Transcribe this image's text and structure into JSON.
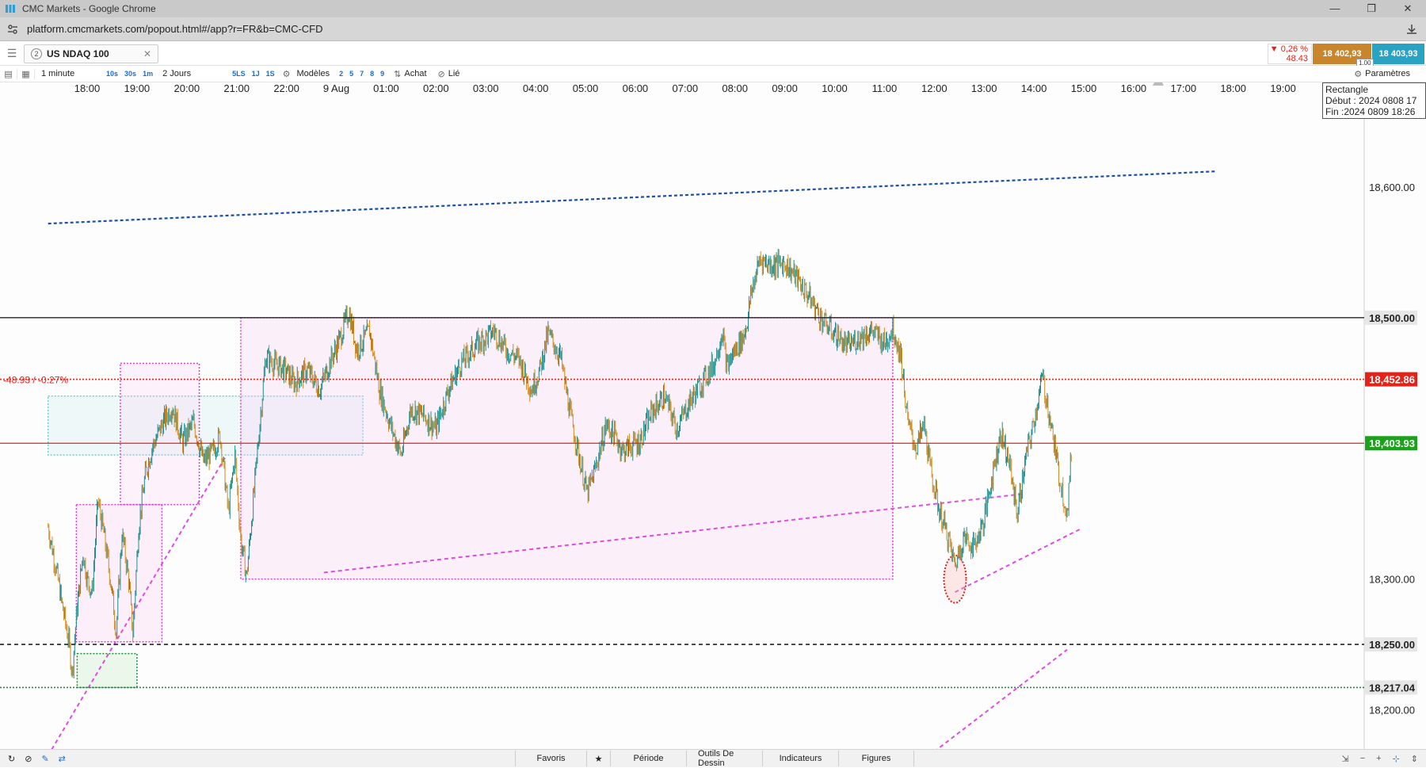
{
  "window": {
    "title": "CMC Markets - Google Chrome",
    "controls": [
      "—",
      "❐",
      "✕"
    ]
  },
  "address": {
    "url": "platform.cmcmarkets.com/popout.html#/app?r=FR&b=CMC-CFD"
  },
  "instrument": {
    "tab_number": "2",
    "name": "US NDAQ 100",
    "change_pct": "▼ 0,26 %",
    "change_pts": "48.43",
    "sell": "18 402,93",
    "buy": "18 403,93",
    "spread": "1.00"
  },
  "toolbar": {
    "interval": "1 minute",
    "quick_intervals": [
      "10s",
      "30s",
      "1m"
    ],
    "range": "2 Jours",
    "quick_ranges": [
      "5LS",
      "1J",
      "1S"
    ],
    "models": "Modèles",
    "model_slots": [
      "2",
      "5",
      "7",
      "8",
      "9"
    ],
    "buy_label": "Achat",
    "linked_label": "Lié",
    "params_label": "Paramètres"
  },
  "tooltip": {
    "line1": "Rectangle",
    "line2": "Début : 2024 0808 17",
    "line3": "Fin :2024 0809 18:26"
  },
  "chart_data": {
    "type": "candlestick",
    "instrument": "US NDAQ 100",
    "timeframe": "1 minute",
    "x_ticks": [
      "18:00",
      "19:00",
      "20:00",
      "21:00",
      "22:00",
      "9 Aug",
      "01:00",
      "02:00",
      "03:00",
      "04:00",
      "05:00",
      "06:00",
      "07:00",
      "08:00",
      "09:00",
      "10:00",
      "11:00",
      "12:00",
      "13:00",
      "14:00",
      "15:00",
      "16:00",
      "17:00",
      "18:00",
      "19:00"
    ],
    "y_ticks": [
      "18,600.00",
      "18,300.00",
      "18,200.00"
    ],
    "ylim": [
      18170,
      18680
    ],
    "levels": [
      {
        "label": "18,500.00",
        "value": 18500.0,
        "color": "#222222",
        "style": "solid"
      },
      {
        "label": "18,452.86",
        "value": 18452.86,
        "color": "#e2231a",
        "style": "dotted"
      },
      {
        "label": "18,403.93",
        "value": 18403.93,
        "color": "#e2231a",
        "style": "solid"
      },
      {
        "label": "18,250.00",
        "value": 18250.0,
        "color": "#222222",
        "style": "dashed"
      },
      {
        "label": "18,217.04",
        "value": 18217.04,
        "color": "#1f8a3a",
        "style": "dotted"
      }
    ],
    "level_badges": {
      "18,452.86": "#e2231a",
      "18,403.93": "#1aa31a",
      "18,500.00": "#e6e6e6",
      "18,250.00": "#e6e6e6",
      "18,217.04": "#e6e6e6"
    },
    "change_label": "-48.93 / -0.27%",
    "price_path": [
      [
        "17:13",
        18340
      ],
      [
        "17:22",
        18310
      ],
      [
        "17:30",
        18280
      ],
      [
        "17:38",
        18252
      ],
      [
        "17:42",
        18228
      ],
      [
        "17:47",
        18272
      ],
      [
        "17:55",
        18320
      ],
      [
        "18:00",
        18300
      ],
      [
        "18:06",
        18290
      ],
      [
        "18:13",
        18360
      ],
      [
        "18:20",
        18335
      ],
      [
        "18:28",
        18300
      ],
      [
        "18:35",
        18260
      ],
      [
        "18:42",
        18335
      ],
      [
        "18:50",
        18300
      ],
      [
        "18:55",
        18258
      ],
      [
        "19:02",
        18340
      ],
      [
        "19:10",
        18380
      ],
      [
        "19:18",
        18400
      ],
      [
        "19:30",
        18418
      ],
      [
        "19:42",
        18432
      ],
      [
        "19:55",
        18405
      ],
      [
        "20:08",
        18420
      ],
      [
        "20:20",
        18390
      ],
      [
        "20:32",
        18398
      ],
      [
        "20:40",
        18410
      ],
      [
        "20:50",
        18352
      ],
      [
        "20:58",
        18395
      ],
      [
        "21:05",
        18330
      ],
      [
        "21:12",
        18302
      ],
      [
        "21:20",
        18360
      ],
      [
        "21:28",
        18420
      ],
      [
        "21:35",
        18470
      ],
      [
        "21:45",
        18465
      ],
      [
        "21:58",
        18460
      ],
      [
        "22:10",
        18450
      ],
      [
        "22:25",
        18460
      ],
      [
        "22:40",
        18445
      ],
      [
        "22:55",
        18470
      ],
      [
        "23:05",
        18485
      ],
      [
        "23:15",
        18505
      ],
      [
        "23:25",
        18475
      ],
      [
        "23:40",
        18490
      ],
      [
        "23:52",
        18445
      ],
      [
        "00:05",
        18418
      ],
      [
        "00:18",
        18395
      ],
      [
        "00:30",
        18430
      ],
      [
        "00:45",
        18425
      ],
      [
        "01:00",
        18415
      ],
      [
        "01:15",
        18445
      ],
      [
        "01:30",
        18465
      ],
      [
        "01:50",
        18480
      ],
      [
        "02:10",
        18490
      ],
      [
        "02:25",
        18475
      ],
      [
        "02:40",
        18468
      ],
      [
        "02:55",
        18445
      ],
      [
        "03:05",
        18460
      ],
      [
        "03:15",
        18488
      ],
      [
        "03:30",
        18470
      ],
      [
        "03:42",
        18425
      ],
      [
        "03:52",
        18395
      ],
      [
        "04:02",
        18365
      ],
      [
        "04:12",
        18385
      ],
      [
        "04:25",
        18418
      ],
      [
        "04:35",
        18410
      ],
      [
        "04:45",
        18398
      ],
      [
        "04:55",
        18402
      ],
      [
        "05:05",
        18405
      ],
      [
        "05:20",
        18428
      ],
      [
        "05:35",
        18440
      ],
      [
        "05:50",
        18415
      ],
      [
        "06:05",
        18435
      ],
      [
        "06:20",
        18450
      ],
      [
        "06:35",
        18465
      ],
      [
        "06:45",
        18490
      ],
      [
        "06:50",
        18462
      ],
      [
        "07:00",
        18475
      ],
      [
        "07:10",
        18485
      ],
      [
        "07:15",
        18498
      ],
      [
        "07:20",
        18520
      ],
      [
        "07:30",
        18545
      ],
      [
        "07:45",
        18540
      ],
      [
        "08:00",
        18542
      ],
      [
        "08:15",
        18530
      ],
      [
        "08:30",
        18515
      ],
      [
        "08:45",
        18498
      ],
      [
        "09:00",
        18488
      ],
      [
        "09:15",
        18478
      ],
      [
        "09:30",
        18485
      ],
      [
        "09:45",
        18490
      ],
      [
        "10:00",
        18480
      ],
      [
        "10:10",
        18492
      ],
      [
        "10:20",
        18470
      ],
      [
        "10:28",
        18420
      ],
      [
        "10:38",
        18400
      ],
      [
        "10:48",
        18418
      ],
      [
        "10:55",
        18385
      ],
      [
        "11:05",
        18355
      ],
      [
        "11:15",
        18335
      ],
      [
        "11:25",
        18310
      ],
      [
        "11:35",
        18332
      ],
      [
        "11:48",
        18325
      ],
      [
        "12:00",
        18345
      ],
      [
        "12:10",
        18380
      ],
      [
        "12:20",
        18412
      ],
      [
        "12:30",
        18390
      ],
      [
        "12:40",
        18350
      ],
      [
        "12:50",
        18392
      ],
      [
        "13:00",
        18420
      ],
      [
        "13:10",
        18455
      ],
      [
        "13:20",
        18420
      ],
      [
        "13:30",
        18380
      ],
      [
        "13:40",
        18350
      ],
      [
        "13:45",
        18395
      ]
    ],
    "annotations": {
      "trendline_blue": {
        "from": [
          "17:13",
          18572
        ],
        "to": [
          "16:40",
          18612
        ]
      },
      "rect_green": {
        "from": [
          "17:48",
          18243
        ],
        "to": [
          "19:00",
          18217
        ]
      },
      "rect_pink_large": {
        "from": [
          "21:05",
          18500
        ],
        "to": [
          "10:10",
          18300
        ]
      },
      "rect_pink_small_1": {
        "from": [
          "17:47",
          18357
        ],
        "to": [
          "19:30",
          18252
        ]
      },
      "rect_pink_small_2": {
        "from": [
          "18:40",
          18465
        ],
        "to": [
          "20:15",
          18357
        ]
      },
      "rect_cyan": {
        "from": [
          "17:13",
          18440
        ],
        "to": [
          "23:32",
          18395
        ]
      }
    }
  },
  "bottombar": {
    "tabs": [
      "Favoris",
      "Période",
      "Outils De Dessin",
      "Indicateurs",
      "Figures"
    ],
    "right_icons": [
      "move-icon",
      "minus-icon",
      "plus-icon",
      "crosshair-icon",
      "vertical-scale-icon"
    ]
  }
}
